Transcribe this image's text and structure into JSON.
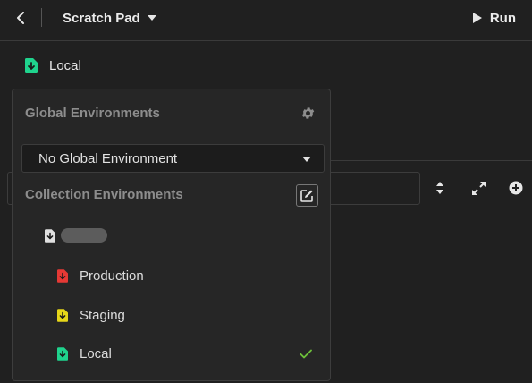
{
  "header": {
    "title": "Scratch Pad",
    "run_label": "Run"
  },
  "environment_selector": {
    "current": "Local"
  },
  "dropdown": {
    "global_title": "Global Environments",
    "global_selected": "No Global Environment",
    "collection_title": "Collection Environments",
    "environments": [
      {
        "label": "Production",
        "color": "#e53935",
        "selected": false
      },
      {
        "label": "Staging",
        "color": "#e6d619",
        "selected": false
      },
      {
        "label": "Local",
        "color": "#1fd38d",
        "selected": true
      }
    ]
  },
  "colors": {
    "accent": "#1fd38d",
    "check": "#6dbf3a"
  }
}
